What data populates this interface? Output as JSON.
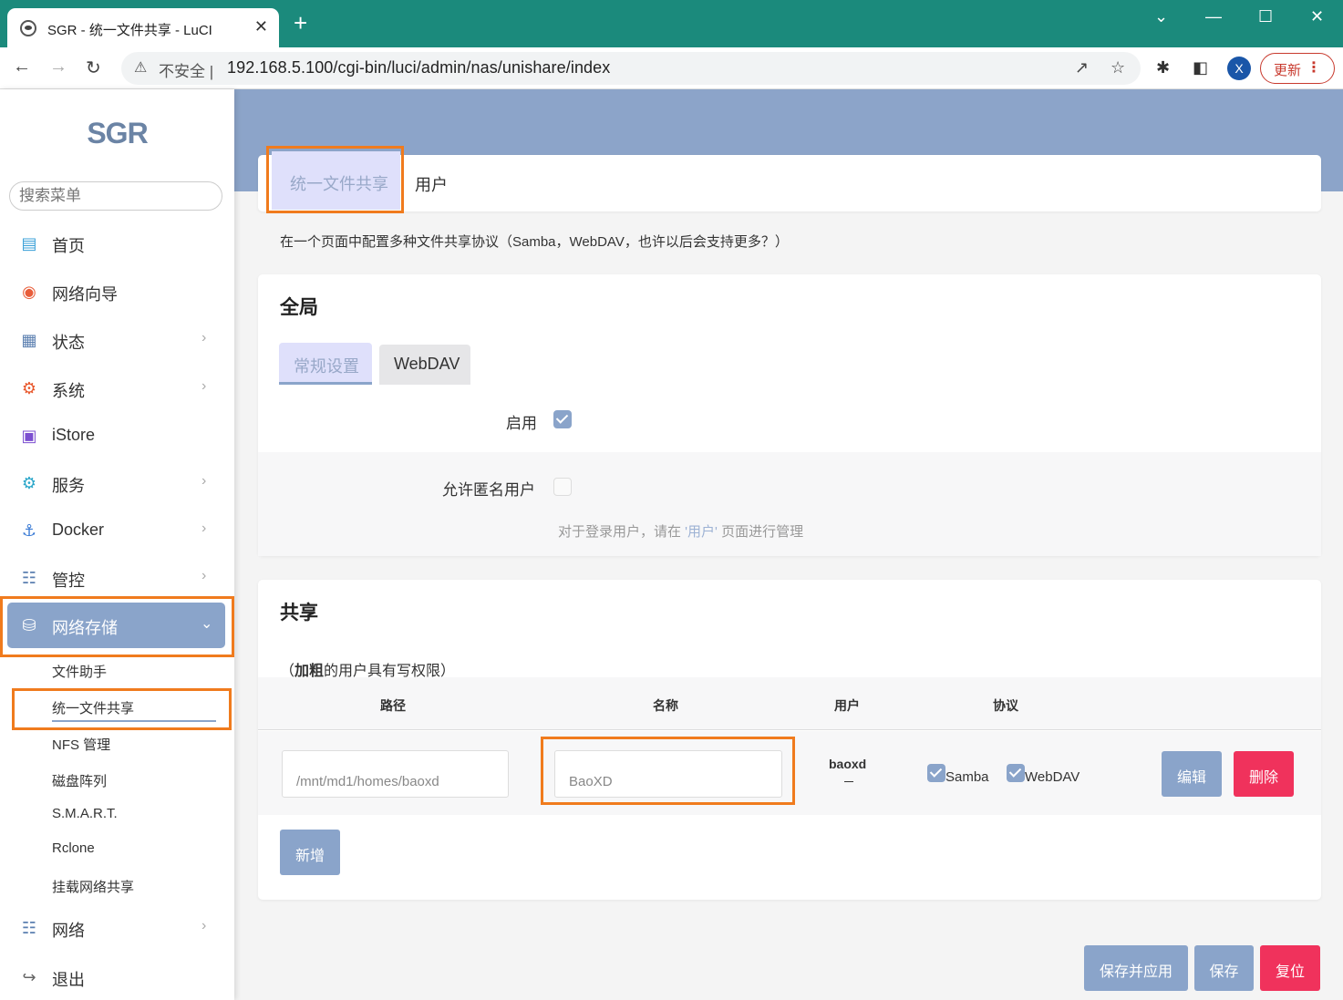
{
  "browser": {
    "tab_title": "SGR - 统一文件共享 - LuCI",
    "tab_close": "✕",
    "new_tab": "+",
    "security_label": "不安全",
    "url": "192.168.5.100/cgi-bin/luci/admin/nas/unishare/index",
    "profile_initial": "X",
    "update_label": "更新",
    "icons": [
      "back-icon",
      "forward-icon",
      "reload-icon",
      "warning-icon",
      "share-icon",
      "star-icon",
      "extensions-icon",
      "sidepanel-icon",
      "kebab-icon"
    ],
    "theme_color": "#1b8a7c"
  },
  "sidebar": {
    "brand": "SGR",
    "search_placeholder": "搜索菜单",
    "items": [
      {
        "label": "首页",
        "icon": "dashboard-icon"
      },
      {
        "label": "网络向导",
        "icon": "globe-icon"
      },
      {
        "label": "状态",
        "icon": "grid-icon"
      },
      {
        "label": "系统",
        "icon": "gear-icon"
      },
      {
        "label": "iStore",
        "icon": "store-icon"
      },
      {
        "label": "服务",
        "icon": "gears-icon"
      },
      {
        "label": "Docker",
        "icon": "docker-icon"
      },
      {
        "label": "管控",
        "icon": "sliders-icon"
      },
      {
        "label": "网络存储",
        "icon": "database-icon"
      },
      {
        "label": "网络",
        "icon": "network-icon"
      },
      {
        "label": "退出",
        "icon": "logout-icon"
      }
    ],
    "subitems": [
      "文件助手",
      "统一文件共享",
      "NFS 管理",
      "磁盘阵列",
      "S.M.A.R.T.",
      "Rclone",
      "挂载网络共享"
    ],
    "active_color": "#8aa4ca"
  },
  "main": {
    "tabs": [
      "统一文件共享",
      "用户"
    ],
    "description": "在一个页面中配置多种文件共享协议（Samba，WebDAV，也许以后会支持更多？）",
    "global": {
      "title": "全局",
      "subtabs": [
        "常规设置",
        "WebDAV"
      ],
      "enable_label": "启用",
      "enable_checked": true,
      "anon_label": "允许匿名用户",
      "anon_checked": false,
      "hint_prefix": "对于登录用户，请在 ",
      "hint_link": "'用户'",
      "hint_suffix": " 页面进行管理"
    },
    "share": {
      "title": "共享",
      "note_open": "（",
      "note_bold": "加粗",
      "note_rest": "的用户具有写权限）",
      "columns": [
        "路径",
        "名称",
        "用户",
        "协议"
      ],
      "rows": [
        {
          "path": "/mnt/md1/homes/baoxd",
          "name": "BaoXD",
          "user": "baoxd",
          "samba_label": "Samba",
          "samba_checked": true,
          "webdav_label": "WebDAV",
          "webdav_checked": true,
          "edit_label": "编辑",
          "delete_label": "删除"
        }
      ],
      "add_label": "新增"
    },
    "footer": {
      "save_apply": "保存并应用",
      "save": "保存",
      "reset": "复位"
    },
    "highlight_color": "#f07b1d",
    "danger_color": "#f0325c"
  }
}
